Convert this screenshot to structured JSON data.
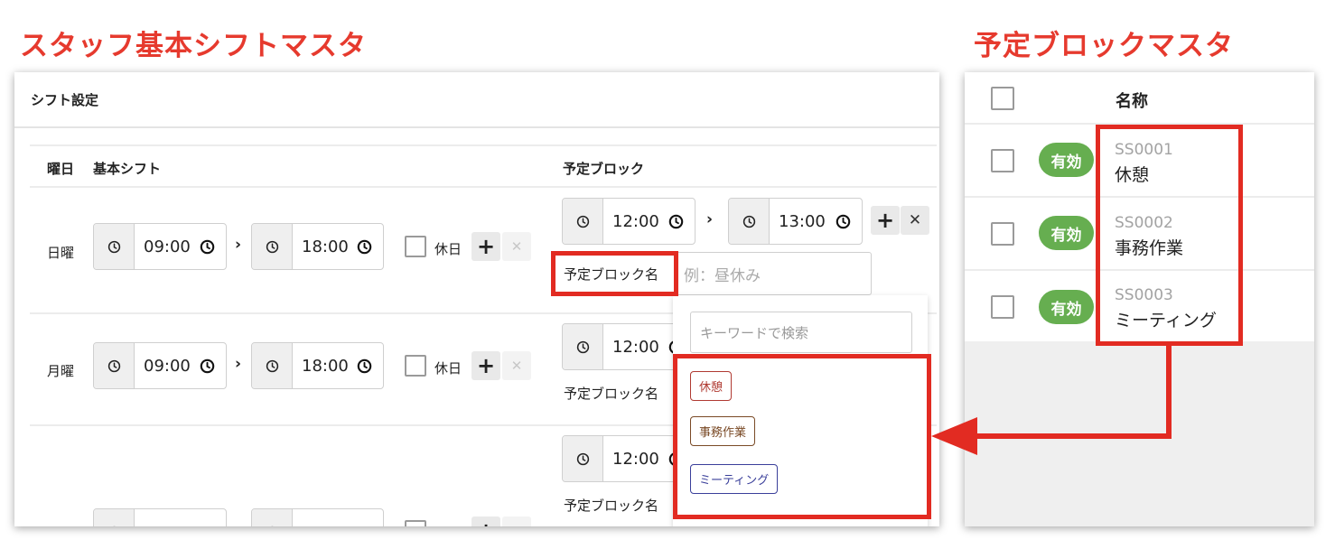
{
  "headings": {
    "left": "スタッフ基本シフトマスタ",
    "right": "予定ブロックマスタ"
  },
  "shift_panel": {
    "title": "シフト設定",
    "headers": {
      "weekday": "曜日",
      "basic_shift": "基本シフト",
      "schedule_block": "予定ブロック"
    },
    "holiday_label": "休日",
    "block_name_label": "予定ブロック名",
    "block_name_placeholder": "例：昼休み",
    "rows": [
      {
        "day": "日曜",
        "start": "09:00",
        "end": "18:00",
        "block_start": "12:00",
        "block_end": "13:00"
      },
      {
        "day": "月曜",
        "start": "09:00",
        "end": "18:00",
        "block_start": "12:00"
      },
      {
        "block_start": "12:00"
      }
    ],
    "dropdown": {
      "search_placeholder": "キーワードで検索",
      "options": [
        {
          "label": "休憩",
          "color": "#b03a32"
        },
        {
          "label": "事務作業",
          "color": "#7a4a26"
        },
        {
          "label": "ミーティング",
          "color": "#3a3f9a"
        }
      ]
    }
  },
  "block_master": {
    "header_name": "名称",
    "rows": [
      {
        "status": "有効",
        "code": "SS0001",
        "name": "休憩"
      },
      {
        "status": "有効",
        "code": "SS0002",
        "name": "事務作業"
      },
      {
        "status": "有効",
        "code": "SS0003",
        "name": "ミーティング"
      }
    ]
  },
  "colors": {
    "accent_red": "#e22b22",
    "badge_green": "#66ae50"
  }
}
